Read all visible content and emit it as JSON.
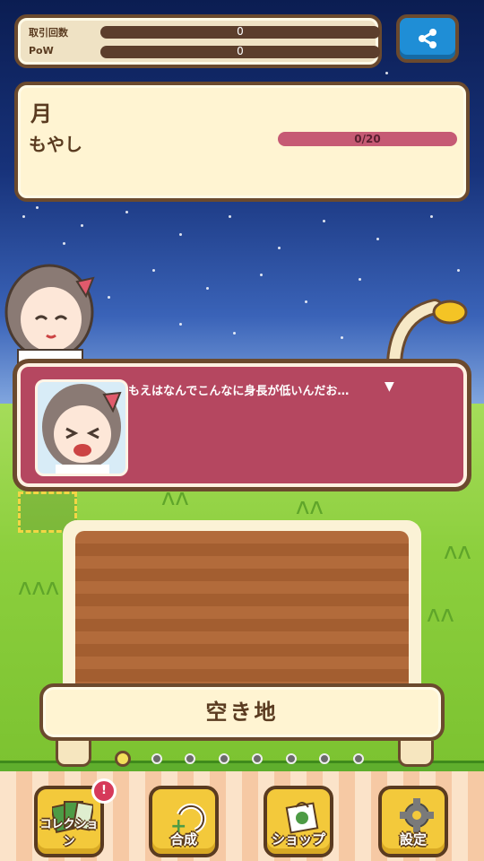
{
  "counters": {
    "trades_label": "取引回数",
    "trades_value": "0",
    "pow_label": "PoW",
    "pow_value": "0"
  },
  "info": {
    "moon_label": "月",
    "plant_name": "もやし",
    "growth_text": "0/20",
    "growth_fraction": 0
  },
  "dialog": {
    "text": "もえはなんでこんなに身長が低いんだお…",
    "more_glyph": "▼"
  },
  "plot": {
    "status": "空き地"
  },
  "pager": {
    "total": 8,
    "active": 0
  },
  "menu": [
    {
      "label": "コレクション",
      "icon": "collection-cards-icon"
    },
    {
      "label": "合成",
      "icon": "synthesis-icon"
    },
    {
      "label": "ショップ",
      "icon": "shop-bag-icon"
    },
    {
      "label": "設定",
      "icon": "gear-icon"
    }
  ],
  "badges": {
    "collection": "!"
  },
  "colors": {
    "frame": "#6b4a2e",
    "panel": "#fff4d2",
    "dialog": "#b54760",
    "share": "#1f8ed6",
    "menu": "#f3c93b"
  }
}
